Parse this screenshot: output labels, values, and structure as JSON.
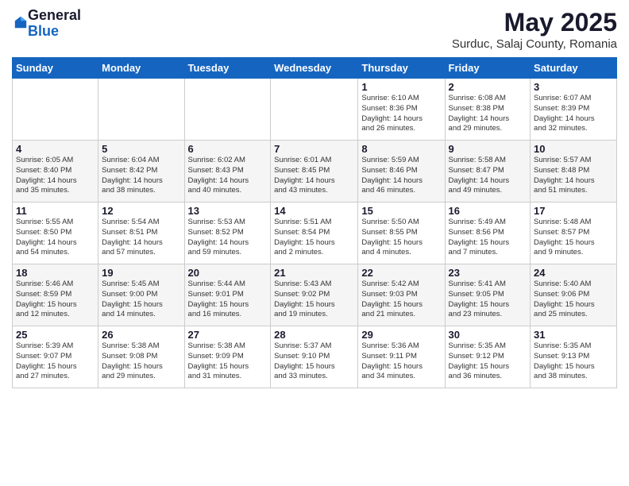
{
  "logo": {
    "general": "General",
    "blue": "Blue"
  },
  "title": "May 2025",
  "location": "Surduc, Salaj County, Romania",
  "days_of_week": [
    "Sunday",
    "Monday",
    "Tuesday",
    "Wednesday",
    "Thursday",
    "Friday",
    "Saturday"
  ],
  "weeks": [
    [
      {
        "day": "",
        "info": ""
      },
      {
        "day": "",
        "info": ""
      },
      {
        "day": "",
        "info": ""
      },
      {
        "day": "",
        "info": ""
      },
      {
        "day": "1",
        "info": "Sunrise: 6:10 AM\nSunset: 8:36 PM\nDaylight: 14 hours\nand 26 minutes."
      },
      {
        "day": "2",
        "info": "Sunrise: 6:08 AM\nSunset: 8:38 PM\nDaylight: 14 hours\nand 29 minutes."
      },
      {
        "day": "3",
        "info": "Sunrise: 6:07 AM\nSunset: 8:39 PM\nDaylight: 14 hours\nand 32 minutes."
      }
    ],
    [
      {
        "day": "4",
        "info": "Sunrise: 6:05 AM\nSunset: 8:40 PM\nDaylight: 14 hours\nand 35 minutes."
      },
      {
        "day": "5",
        "info": "Sunrise: 6:04 AM\nSunset: 8:42 PM\nDaylight: 14 hours\nand 38 minutes."
      },
      {
        "day": "6",
        "info": "Sunrise: 6:02 AM\nSunset: 8:43 PM\nDaylight: 14 hours\nand 40 minutes."
      },
      {
        "day": "7",
        "info": "Sunrise: 6:01 AM\nSunset: 8:45 PM\nDaylight: 14 hours\nand 43 minutes."
      },
      {
        "day": "8",
        "info": "Sunrise: 5:59 AM\nSunset: 8:46 PM\nDaylight: 14 hours\nand 46 minutes."
      },
      {
        "day": "9",
        "info": "Sunrise: 5:58 AM\nSunset: 8:47 PM\nDaylight: 14 hours\nand 49 minutes."
      },
      {
        "day": "10",
        "info": "Sunrise: 5:57 AM\nSunset: 8:48 PM\nDaylight: 14 hours\nand 51 minutes."
      }
    ],
    [
      {
        "day": "11",
        "info": "Sunrise: 5:55 AM\nSunset: 8:50 PM\nDaylight: 14 hours\nand 54 minutes."
      },
      {
        "day": "12",
        "info": "Sunrise: 5:54 AM\nSunset: 8:51 PM\nDaylight: 14 hours\nand 57 minutes."
      },
      {
        "day": "13",
        "info": "Sunrise: 5:53 AM\nSunset: 8:52 PM\nDaylight: 14 hours\nand 59 minutes."
      },
      {
        "day": "14",
        "info": "Sunrise: 5:51 AM\nSunset: 8:54 PM\nDaylight: 15 hours\nand 2 minutes."
      },
      {
        "day": "15",
        "info": "Sunrise: 5:50 AM\nSunset: 8:55 PM\nDaylight: 15 hours\nand 4 minutes."
      },
      {
        "day": "16",
        "info": "Sunrise: 5:49 AM\nSunset: 8:56 PM\nDaylight: 15 hours\nand 7 minutes."
      },
      {
        "day": "17",
        "info": "Sunrise: 5:48 AM\nSunset: 8:57 PM\nDaylight: 15 hours\nand 9 minutes."
      }
    ],
    [
      {
        "day": "18",
        "info": "Sunrise: 5:46 AM\nSunset: 8:59 PM\nDaylight: 15 hours\nand 12 minutes."
      },
      {
        "day": "19",
        "info": "Sunrise: 5:45 AM\nSunset: 9:00 PM\nDaylight: 15 hours\nand 14 minutes."
      },
      {
        "day": "20",
        "info": "Sunrise: 5:44 AM\nSunset: 9:01 PM\nDaylight: 15 hours\nand 16 minutes."
      },
      {
        "day": "21",
        "info": "Sunrise: 5:43 AM\nSunset: 9:02 PM\nDaylight: 15 hours\nand 19 minutes."
      },
      {
        "day": "22",
        "info": "Sunrise: 5:42 AM\nSunset: 9:03 PM\nDaylight: 15 hours\nand 21 minutes."
      },
      {
        "day": "23",
        "info": "Sunrise: 5:41 AM\nSunset: 9:05 PM\nDaylight: 15 hours\nand 23 minutes."
      },
      {
        "day": "24",
        "info": "Sunrise: 5:40 AM\nSunset: 9:06 PM\nDaylight: 15 hours\nand 25 minutes."
      }
    ],
    [
      {
        "day": "25",
        "info": "Sunrise: 5:39 AM\nSunset: 9:07 PM\nDaylight: 15 hours\nand 27 minutes."
      },
      {
        "day": "26",
        "info": "Sunrise: 5:38 AM\nSunset: 9:08 PM\nDaylight: 15 hours\nand 29 minutes."
      },
      {
        "day": "27",
        "info": "Sunrise: 5:38 AM\nSunset: 9:09 PM\nDaylight: 15 hours\nand 31 minutes."
      },
      {
        "day": "28",
        "info": "Sunrise: 5:37 AM\nSunset: 9:10 PM\nDaylight: 15 hours\nand 33 minutes."
      },
      {
        "day": "29",
        "info": "Sunrise: 5:36 AM\nSunset: 9:11 PM\nDaylight: 15 hours\nand 34 minutes."
      },
      {
        "day": "30",
        "info": "Sunrise: 5:35 AM\nSunset: 9:12 PM\nDaylight: 15 hours\nand 36 minutes."
      },
      {
        "day": "31",
        "info": "Sunrise: 5:35 AM\nSunset: 9:13 PM\nDaylight: 15 hours\nand 38 minutes."
      }
    ]
  ]
}
